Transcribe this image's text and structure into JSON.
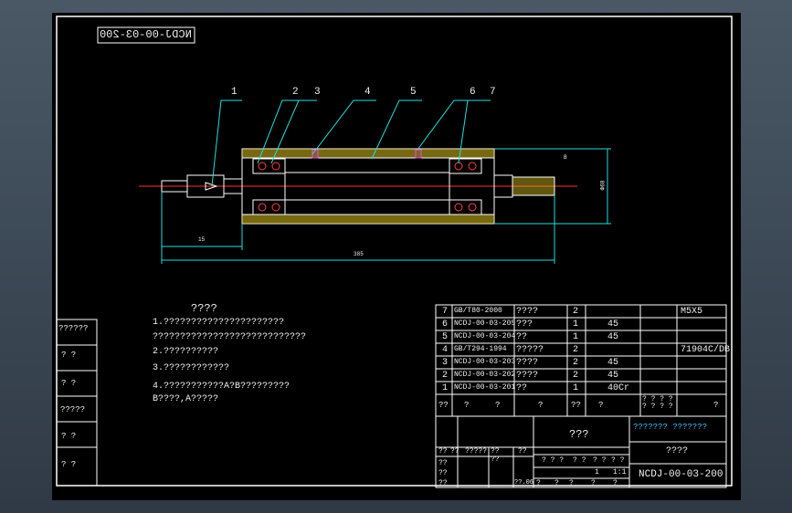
{
  "drawing_number_mirrored": "NCDJ-00-03-200",
  "balloons": [
    "1",
    "2",
    "3",
    "4",
    "5",
    "6",
    "7"
  ],
  "dims": {
    "length_left": "15",
    "length_total": "385",
    "diameter": "Ф68",
    "thread_note": "B"
  },
  "notes": {
    "title": "????",
    "items": [
      "1.??????????????????????",
      "  ????????????????????????????",
      "2.??????????",
      "3.????????????",
      "4.???????????A?B?????????",
      "  B????,A?????"
    ]
  },
  "left_column": [
    "??????",
    "?  ?",
    "?  ?",
    "?????",
    "?  ?",
    "?  ?"
  ],
  "bom": {
    "rows": [
      {
        "no": "7",
        "code": "GB/T80-2000",
        "name": "????",
        "qty": "2",
        "mat": "",
        "note": "M5X5"
      },
      {
        "no": "6",
        "code": "NCDJ-00-03-205",
        "name": "???",
        "qty": "1",
        "mat": "45",
        "note": ""
      },
      {
        "no": "5",
        "code": "NCDJ-00-03-204",
        "name": "??",
        "qty": "1",
        "mat": "45",
        "note": ""
      },
      {
        "no": "4",
        "code": "GB/T294-1994",
        "name": "?????",
        "qty": "2",
        "mat": "",
        "note": "71904C/DB"
      },
      {
        "no": "3",
        "code": "NCDJ-00-03-203",
        "name": "????",
        "qty": "2",
        "mat": "45",
        "note": ""
      },
      {
        "no": "2",
        "code": "NCDJ-00-03-202",
        "name": "????",
        "qty": "2",
        "mat": "45",
        "note": ""
      },
      {
        "no": "1",
        "code": "NCDJ-00-03-201",
        "name": "??",
        "qty": "1",
        "mat": "40Cr",
        "note": ""
      }
    ],
    "header": {
      "no": "??",
      "code": "?",
      "name": "?",
      "qty": "??",
      "c1": "?",
      "c2": "?",
      "c3": "? ? ? ?\n? ? ? ?",
      "note": "?"
    }
  },
  "title_block": {
    "part_name": "???",
    "company": "??????? ???????",
    "subtitle": "????",
    "drawing_number": "NCDJ-00-03-200",
    "labels_row1": [
      "??",
      "??",
      "?????",
      "??",
      "??"
    ],
    "labels_mid": [
      "? ? ?",
      "? ?",
      "? ?",
      "? ?"
    ],
    "scale": "1:1",
    "qty": "1",
    "sheet": [
      "?",
      "?",
      "?",
      "?",
      "?"
    ],
    "left_labels": [
      "??",
      "??",
      "??",
      "??"
    ],
    "date": "??.06"
  }
}
